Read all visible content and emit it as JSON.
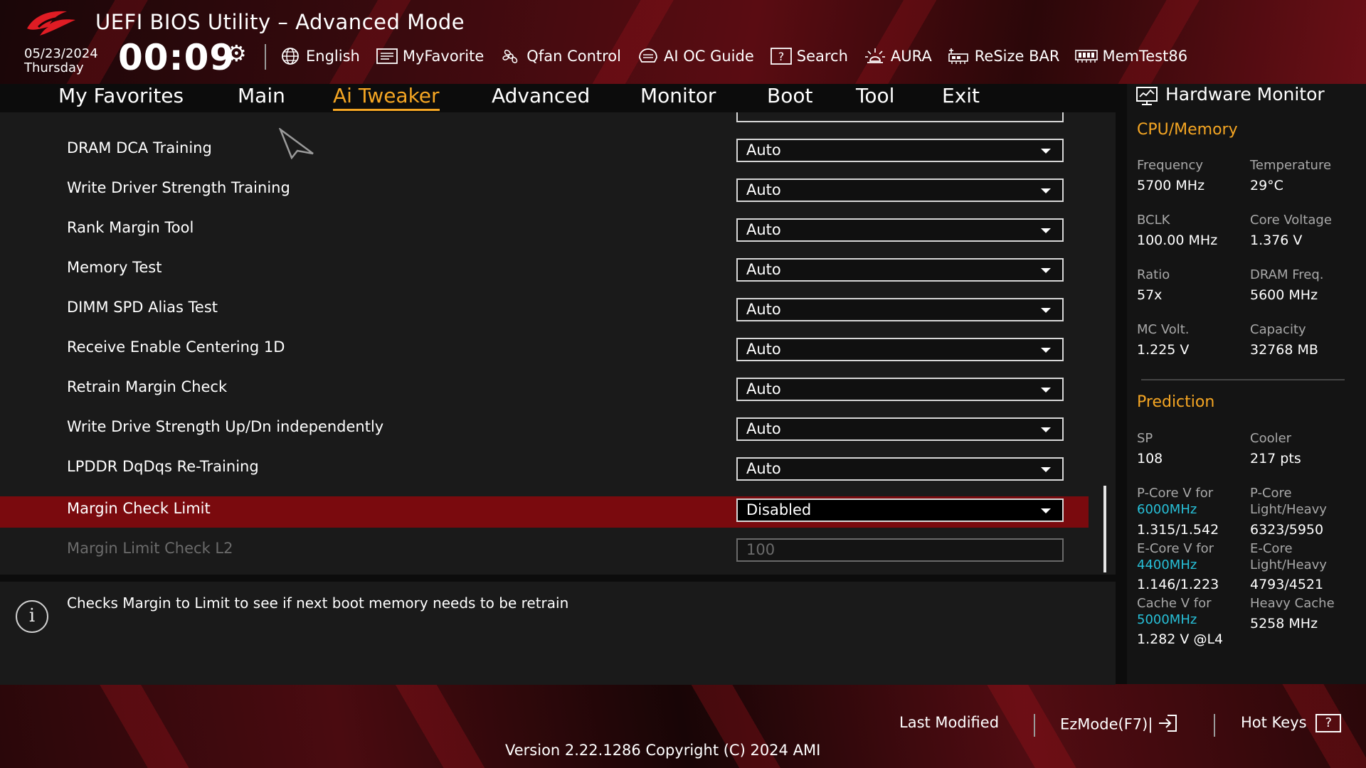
{
  "header": {
    "title": "UEFI BIOS Utility – Advanced Mode",
    "date": "05/23/2024",
    "day": "Thursday",
    "time": "00:09"
  },
  "toolbar": {
    "items": [
      {
        "label": "English",
        "icon": "globe-icon"
      },
      {
        "label": "MyFavorite",
        "icon": "favorite-list-icon"
      },
      {
        "label": "Qfan Control",
        "icon": "fan-icon"
      },
      {
        "label": "AI OC Guide",
        "icon": "ai-chip-icon"
      },
      {
        "label": "Search",
        "icon": "search-question-icon"
      },
      {
        "label": "AURA",
        "icon": "aura-light-icon"
      },
      {
        "label": "ReSize BAR",
        "icon": "resize-bar-icon"
      },
      {
        "label": "MemTest86",
        "icon": "memory-icon"
      }
    ]
  },
  "tabs": [
    {
      "label": "My Favorites"
    },
    {
      "label": "Main"
    },
    {
      "label": "Ai Tweaker",
      "active": true
    },
    {
      "label": "Advanced"
    },
    {
      "label": "Monitor"
    },
    {
      "label": "Boot"
    },
    {
      "label": "Tool"
    },
    {
      "label": "Exit"
    }
  ],
  "settings": [
    {
      "label": "DRAM DCA Training",
      "value": "Auto"
    },
    {
      "label": "Write Driver Strength Training",
      "value": "Auto"
    },
    {
      "label": "Rank Margin Tool",
      "value": "Auto"
    },
    {
      "label": "Memory Test",
      "value": "Auto"
    },
    {
      "label": "DIMM SPD Alias Test",
      "value": "Auto"
    },
    {
      "label": "Receive Enable Centering 1D",
      "value": "Auto"
    },
    {
      "label": "Retrain Margin Check",
      "value": "Auto"
    },
    {
      "label": "Write Drive Strength Up/Dn independently",
      "value": "Auto"
    },
    {
      "label": "LPDDR DqDqs Re-Training",
      "value": "Auto"
    },
    {
      "label": "Margin Check Limit",
      "value": "Disabled",
      "selected": true
    },
    {
      "label": "Margin Limit Check L2",
      "value": "100",
      "disabled": true
    }
  ],
  "description": "Checks Margin to Limit to see if next boot memory needs to be retrain",
  "hardware_monitor": {
    "title": "Hardware Monitor",
    "cpu_memory": {
      "heading": "CPU/Memory",
      "frequency_label": "Frequency",
      "frequency": "5700 MHz",
      "temperature_label": "Temperature",
      "temperature": "29°C",
      "bclk_label": "BCLK",
      "bclk": "100.00 MHz",
      "core_voltage_label": "Core Voltage",
      "core_voltage": "1.376 V",
      "ratio_label": "Ratio",
      "ratio": "57x",
      "dram_freq_label": "DRAM Freq.",
      "dram_freq": "5600 MHz",
      "mc_volt_label": "MC Volt.",
      "mc_volt": "1.225 V",
      "capacity_label": "Capacity",
      "capacity": "32768 MB"
    },
    "prediction": {
      "heading": "Prediction",
      "sp_label": "SP",
      "sp": "108",
      "cooler_label": "Cooler",
      "cooler": "217 pts",
      "pcore_v_label": "P-Core V for",
      "pcore_v_freq": "6000MHz",
      "pcore_v": "1.315/1.542",
      "pcore_lh_label1": "P-Core",
      "pcore_lh_label2": "Light/Heavy",
      "pcore_lh": "6323/5950",
      "ecore_v_label": "E-Core V for",
      "ecore_v_freq": "4400MHz",
      "ecore_v": "1.146/1.223",
      "ecore_lh_label1": "E-Core",
      "ecore_lh_label2": "Light/Heavy",
      "ecore_lh": "4793/4521",
      "cache_v_label": "Cache V for",
      "cache_v_freq": "5000MHz",
      "cache_v": "1.282 V @L4",
      "heavy_cache_label": "Heavy Cache",
      "heavy_cache": "5258 MHz"
    }
  },
  "footer": {
    "last_modified": "Last Modified",
    "ezmode": "EzMode(F7)|",
    "hotkeys": "Hot Keys",
    "version": "Version 2.22.1286 Copyright (C) 2024 AMI"
  },
  "colors": {
    "accent": "#f5a623",
    "highlight": "#7a0a0e",
    "cyan": "#27c0d8"
  }
}
